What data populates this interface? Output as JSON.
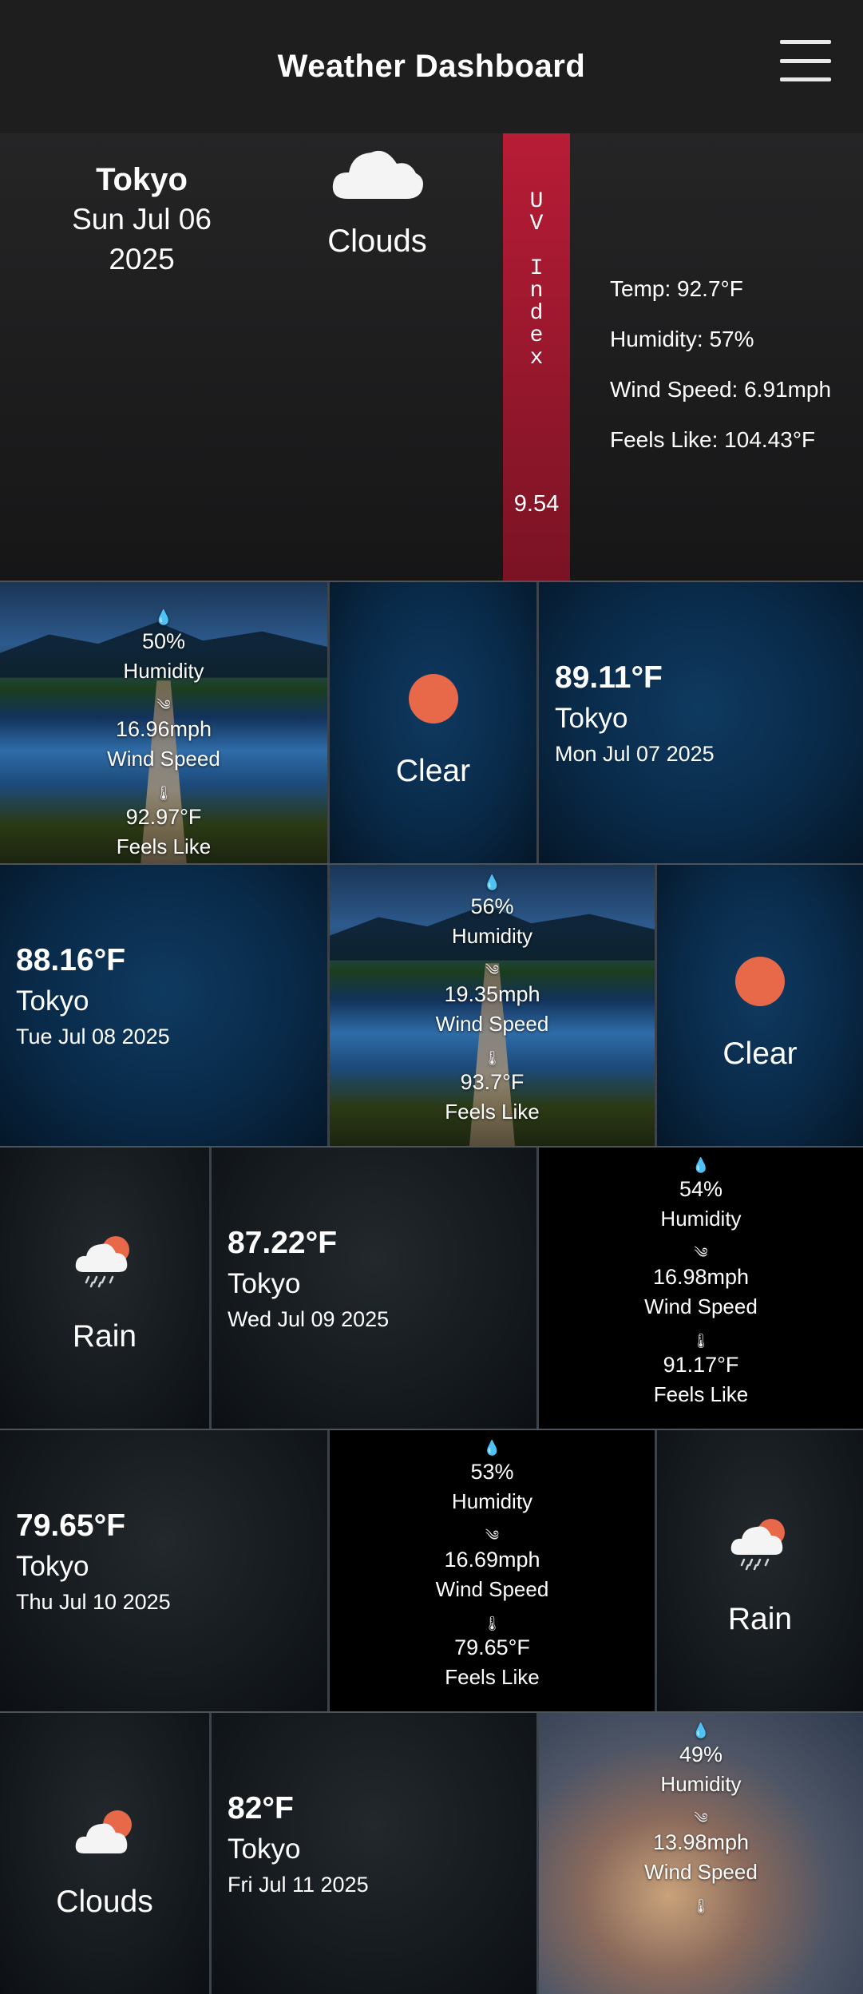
{
  "header": {
    "title": "Weather Dashboard"
  },
  "today": {
    "city": "Tokyo",
    "date_line1": "Sun Jul 06",
    "date_line2": "2025",
    "condition": "Clouds",
    "uv_label": "UV Index",
    "uv_value": "9.54",
    "temp": "Temp: 92.7°F",
    "humidity": "Humidity: 57%",
    "wind": "Wind Speed: 6.91mph",
    "feels": "Feels Like: 104.43°F"
  },
  "stat_labels": {
    "humidity": "Humidity",
    "wind": "Wind Speed",
    "feels": "Feels Like"
  },
  "forecast": [
    {
      "temp": "89.11°F",
      "city": "Tokyo",
      "date": "Mon Jul 07 2025",
      "condition": "Clear",
      "humidity": "50%",
      "wind": "16.96mph",
      "feels": "92.97°F"
    },
    {
      "temp": "88.16°F",
      "city": "Tokyo",
      "date": "Tue Jul 08 2025",
      "condition": "Clear",
      "humidity": "56%",
      "wind": "19.35mph",
      "feels": "93.7°F"
    },
    {
      "temp": "87.22°F",
      "city": "Tokyo",
      "date": "Wed Jul 09 2025",
      "condition": "Rain",
      "humidity": "54%",
      "wind": "16.98mph",
      "feels": "91.17°F"
    },
    {
      "temp": "79.65°F",
      "city": "Tokyo",
      "date": "Thu Jul 10 2025",
      "condition": "Rain",
      "humidity": "53%",
      "wind": "16.69mph",
      "feels": "79.65°F"
    },
    {
      "temp": "82°F",
      "city": "Tokyo",
      "date": "Fri Jul 11 2025",
      "condition": "Clouds",
      "humidity": "49%",
      "wind": "13.98mph",
      "feels": ""
    }
  ],
  "colors": {
    "sun": "#e8694a",
    "uv": "#b81c36",
    "header_bg": "#1e1e1f"
  },
  "icons": {
    "menu": "hamburger-icon",
    "humidity": "droplet-icon",
    "wind": "wind-icon",
    "feels": "thermometer-icon"
  }
}
